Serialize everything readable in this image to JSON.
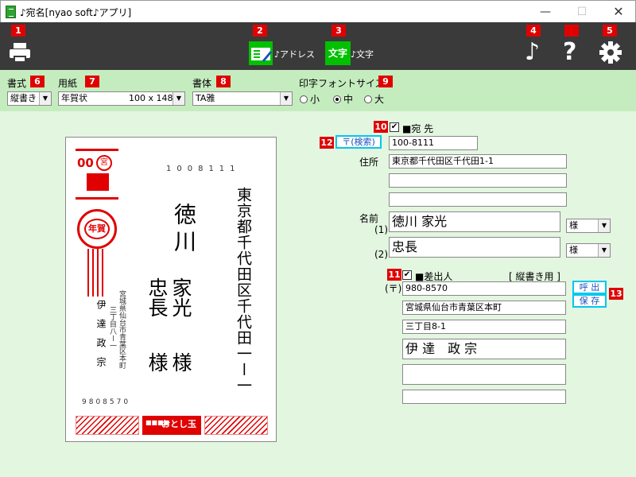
{
  "window": {
    "title": "♪宛名[nyao soft♪アプリ]",
    "minimize": "—",
    "maximize": "☐",
    "close": "✕"
  },
  "badges": [
    "1",
    "2",
    "3",
    "4",
    "5",
    "6",
    "7",
    "8",
    "9",
    "10",
    "11",
    "12",
    "13"
  ],
  "toolbar": {
    "mode_address_label": "♪アドレス",
    "mode_text_label": "♪文字",
    "mode_text_icon": "文字",
    "help": "?",
    "note": "♪",
    "icons": [
      "printer-icon",
      "address-book-icon",
      "text-icon",
      "music-note-icon",
      "help-icon",
      "gear-icon"
    ]
  },
  "options": {
    "format_label": "書式",
    "format_value": "縦書き",
    "paper_label": "用紙",
    "paper_value": "年賀状",
    "paper_size": "100 x 148",
    "font_label": "書体",
    "font_value": "TA雅",
    "size_label": "印字フォントサイズ",
    "sizes": [
      "小",
      "中",
      "大"
    ],
    "size_selected": "中"
  },
  "card": {
    "stamp_value": "00",
    "stamp_seal": "宮",
    "nenga": "年賀",
    "postal_code": "1008111",
    "address": "東京都千代田区千代田一ー一",
    "name_family": "徳川",
    "name_given1": "家光",
    "name_given2": "忠長",
    "honorific": "様",
    "honorific2": "様",
    "sender_address1": "宮城県仙台市青葉区本町",
    "sender_address2": "三丁目八ー一",
    "sender_name": "伊達政宗",
    "sender_postal": "9808570",
    "deco_text": "おとし玉"
  },
  "recipient": {
    "label": "■宛 先",
    "checked": "✔",
    "postal_search": "〒(検索)",
    "postal": "100-8111",
    "address_label": "住所",
    "address1": "東京都千代田区千代田1-1",
    "address2": "",
    "address3": "",
    "name_label": "名前",
    "name1_index": "(1)",
    "name1": "徳川 家光",
    "name1_hon": "様",
    "name2_index": "(2)",
    "name2": "忠長",
    "name2_hon": "様"
  },
  "sender": {
    "label": "■差出人",
    "checked": "✔",
    "vertical_note": "[ 縦書き用 ]",
    "postal_mark": "(〒)",
    "postal": "980-8570",
    "address1": "宮城県仙台市青葉区本町",
    "address2": "三丁目8-1",
    "name": "伊 達　政 宗",
    "extra1": "",
    "extra2": "",
    "load_button": "呼 出",
    "save_button": "保 存"
  },
  "colors": {
    "toolbar_bg": "#3a3a3a",
    "option_bg": "#c5ecbf",
    "main_bg": "#e3f6e0",
    "accent_green": "#00c000",
    "badge_red": "#e00000",
    "link_border": "#00c8f0"
  }
}
